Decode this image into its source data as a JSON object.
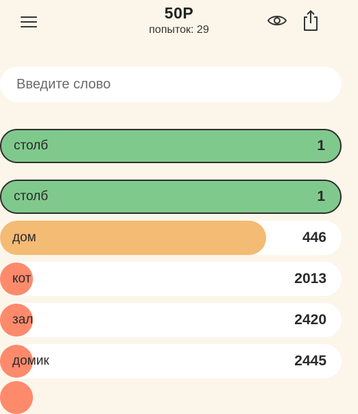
{
  "header": {
    "title": "50P",
    "attempts": "попыток: 29",
    "menu_icon": "hamburger-menu-icon",
    "eye_icon": "eye-icon",
    "share_icon": "share-icon"
  },
  "search": {
    "placeholder": "Введите слово",
    "value": ""
  },
  "best_guess": {
    "word": "столб",
    "rank": "1"
  },
  "guesses": [
    {
      "word": "столб",
      "rank": "1",
      "closeness": 1.0,
      "color": "#80c98d"
    },
    {
      "word": "дом",
      "rank": "446",
      "closeness": 0.78,
      "color": "#f4bb74"
    },
    {
      "word": "кот",
      "rank": "2013",
      "closeness": 0.05,
      "color": "#fe8a6c"
    },
    {
      "word": "зал",
      "rank": "2420",
      "closeness": 0.05,
      "color": "#fe8a6c"
    },
    {
      "word": "домик",
      "rank": "2445",
      "closeness": 0.05,
      "color": "#fe8a6c"
    }
  ],
  "colors": {
    "background": "#fcf6ea",
    "close": "#80c98d",
    "medium": "#f4bb74",
    "far": "#fe8a6c"
  }
}
